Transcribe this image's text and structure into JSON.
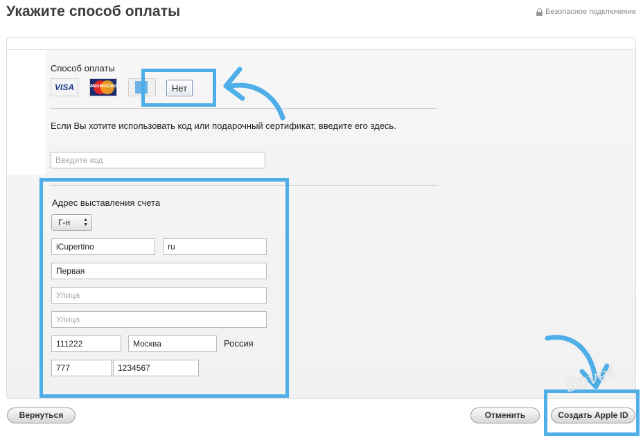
{
  "header": {
    "title": "Укажите способ оплаты",
    "secure_label": "Безопасное подключение"
  },
  "payment": {
    "section_label": "Способ оплаты",
    "cards": [
      {
        "name": "VISA",
        "icon": "visa-card-icon"
      },
      {
        "name": "MasterCard",
        "icon": "mastercard-icon"
      },
      {
        "name": "American Express",
        "icon": "amex-card-icon"
      }
    ],
    "none_button": "Нет"
  },
  "code": {
    "hint": "Если Вы хотите использовать код или подарочный сертификат, введите его здесь.",
    "placeholder": "Введите код"
  },
  "billing": {
    "section_label": "Адрес выставления счета",
    "salutation": "Г-н",
    "first_name": "iCupertino",
    "last_name": "ru",
    "street1": "Первая",
    "street2_placeholder": "Улица",
    "street3_placeholder": "Улица",
    "postal_code": "111222",
    "city": "Москва",
    "country": "Россия",
    "phone_area": "777",
    "phone_number": "1234567"
  },
  "footer": {
    "back_label": "Вернуться",
    "cancel_label": "Отменить",
    "create_label": "Создать Apple ID"
  },
  "colors": {
    "highlight": "#4daee8",
    "panel_bg": "#f3f3f3"
  },
  "watermark": "Sovet"
}
